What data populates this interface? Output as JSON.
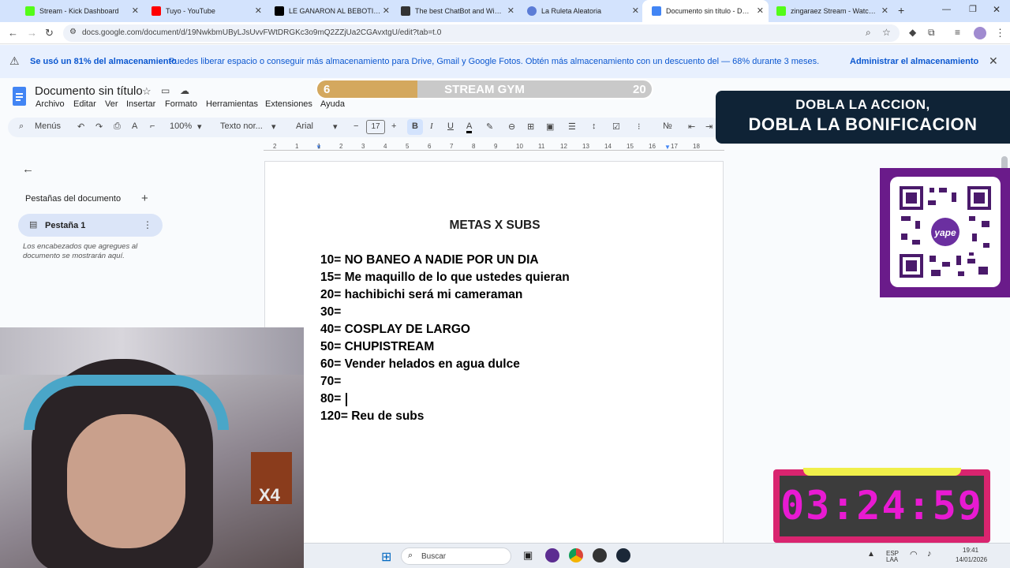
{
  "tabs": [
    {
      "label": "Stream - Kick Dashboard",
      "color": "#53fc18"
    },
    {
      "label": "Tuyo - YouTube",
      "color": "#ff0000"
    },
    {
      "label": "LE GANARON AL BEBOTISMOO",
      "color": "#000000"
    },
    {
      "label": "The best ChatBot and Widgets",
      "color": "#333333"
    },
    {
      "label": "La Ruleta Aleatoria",
      "color": "#5b7cd6"
    },
    {
      "label": "Documento sin título - Docum",
      "color": "#4285f4"
    },
    {
      "label": "zingaraez Stream - Watch Live",
      "color": "#53fc18"
    }
  ],
  "new_tab": "+",
  "address": {
    "url": "docs.google.com/document/d/19NwkbmUByLJsUvvFWtDRGKc3o9mQ2ZZjUa2CGAvxtgU/edit?tab=t.0"
  },
  "banner": {
    "strong": "Se usó un 81% del almacenamiento",
    "text": "Puedes liberar espacio o conseguir más almacenamiento para Drive, Gmail y Google Fotos. Obtén más almacenamiento con un descuento del — 68% durante 3 meses.",
    "action": "Administrar el almacenamiento"
  },
  "doc": {
    "title": "Documento sin título",
    "menus": [
      "Archivo",
      "Editar",
      "Ver",
      "Insertar",
      "Formato",
      "Herramientas",
      "Extensiones",
      "Ayuda"
    ]
  },
  "toolbar": {
    "search": "Menús",
    "zoom": "100%",
    "style": "Texto nor...",
    "font": "Arial",
    "size": "17"
  },
  "ruler": [
    "2",
    "1",
    "1",
    "2",
    "3",
    "4",
    "5",
    "6",
    "7",
    "8",
    "9",
    "10",
    "11",
    "12",
    "13",
    "14",
    "15",
    "16",
    "17",
    "18"
  ],
  "sidebar": {
    "heading": "Pestañas del documento",
    "tab": "Pestaña 1",
    "hint": "Los encabezados que agregues al documento se mostrarán aquí."
  },
  "content": {
    "heading": "METAS X SUBS",
    "lines": [
      "10= NO BANEO A NADIE POR UN DIA",
      "15= Me maquillo de lo que ustedes quieran",
      "20= hachibichi será mi cameraman",
      "30=",
      "40= COSPLAY DE LARGO",
      "50= CHUPISTREAM",
      "60= Vender helados en agua dulce",
      "70=",
      "80=",
      "120= Reu de subs"
    ]
  },
  "overlay": {
    "gym": {
      "left": "6",
      "title": "STREAM GYM",
      "right": "20",
      "progress": 0.3
    },
    "promo": {
      "line1": "DOBLA LA ACCION,",
      "line2": "DOBLA LA BONIFICACION"
    },
    "qr_label": "yape",
    "cam_badge": "X4",
    "timer": "03:24:59"
  },
  "taskbar": {
    "search": "Buscar",
    "time": "19:41",
    "date": "14/01/2026",
    "lang": "ESP LAA"
  }
}
